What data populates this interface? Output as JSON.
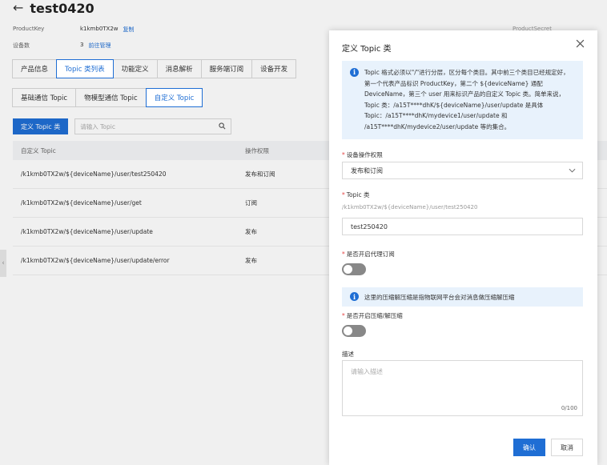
{
  "page": {
    "back_icon": "arrow-left-icon",
    "title": "test0420",
    "product_key_label": "ProductKey",
    "product_key_value": "k1kmb0TX2w",
    "copy_label": "复制",
    "device_count_label": "设备数",
    "device_count_value": "3",
    "manage_label": "前往管理",
    "product_secret_label": "ProductSecret",
    "product_secret_value": "******** 3"
  },
  "tabs": [
    "产品信息",
    "Topic 类列表",
    "功能定义",
    "消息解析",
    "服务端订阅",
    "设备开发"
  ],
  "subtabs": [
    "基础通信 Topic",
    "物模型通信 Topic",
    "自定义 Topic"
  ],
  "toolbar": {
    "define_button": "定义 Topic 类",
    "search_placeholder": "请输入 Topic",
    "search_icon": "search-icon"
  },
  "table": {
    "headers": [
      "自定义 Topic",
      "操作权限",
      "描述"
    ],
    "rows": [
      {
        "topic": "/k1kmb0TX2w/${deviceName}/user/test250420",
        "permission": "发布和订阅"
      },
      {
        "topic": "/k1kmb0TX2w/${deviceName}/user/get",
        "permission": "订阅"
      },
      {
        "topic": "/k1kmb0TX2w/${deviceName}/user/update",
        "permission": "发布"
      },
      {
        "topic": "/k1kmb0TX2w/${deviceName}/user/update/error",
        "permission": "发布"
      }
    ],
    "partial_header": "解",
    "partial_cell": "题"
  },
  "dialog": {
    "title": "定义 Topic 类",
    "close_icon": "close-icon",
    "notice": "Topic 格式必须以\"/\"进行分层，区分每个类目。其中前三个类目已经规定好，第一个代表产品标识 ProductKey，第二个 ${deviceName} 通配 DeviceName，第三个 user 用来标识产品的自定义 Topic 类。简单来说，Topic 类：/a15T****dhK/${deviceName}/user/update 是具体 Topic：/a15T****dhK/mydevice1/user/update 和 /a15T****dhK/mydevice2/user/update 等的集合。",
    "permission_label": "设备操作权限",
    "permission_value": "发布和订阅",
    "topic_label": "Topic 类",
    "topic_hint": "/k1kmb0TX2w/${deviceName}/user/test250420",
    "topic_value": "test250420",
    "proxy_label": "是否开启代理订阅",
    "proxy_on": false,
    "compress_notice": "这里的压缩解压缩是指物联网平台会对消息做压缩解压缩",
    "compress_label": "是否开启压缩/解压缩",
    "compress_on": false,
    "desc_label": "描述",
    "desc_placeholder": "请输入描述",
    "desc_counter": "0/100",
    "confirm": "确认",
    "cancel": "取消"
  },
  "colors": {
    "primary": "#1f6ed4",
    "notice_bg": "#e8f2fc",
    "required": "#e54545"
  }
}
